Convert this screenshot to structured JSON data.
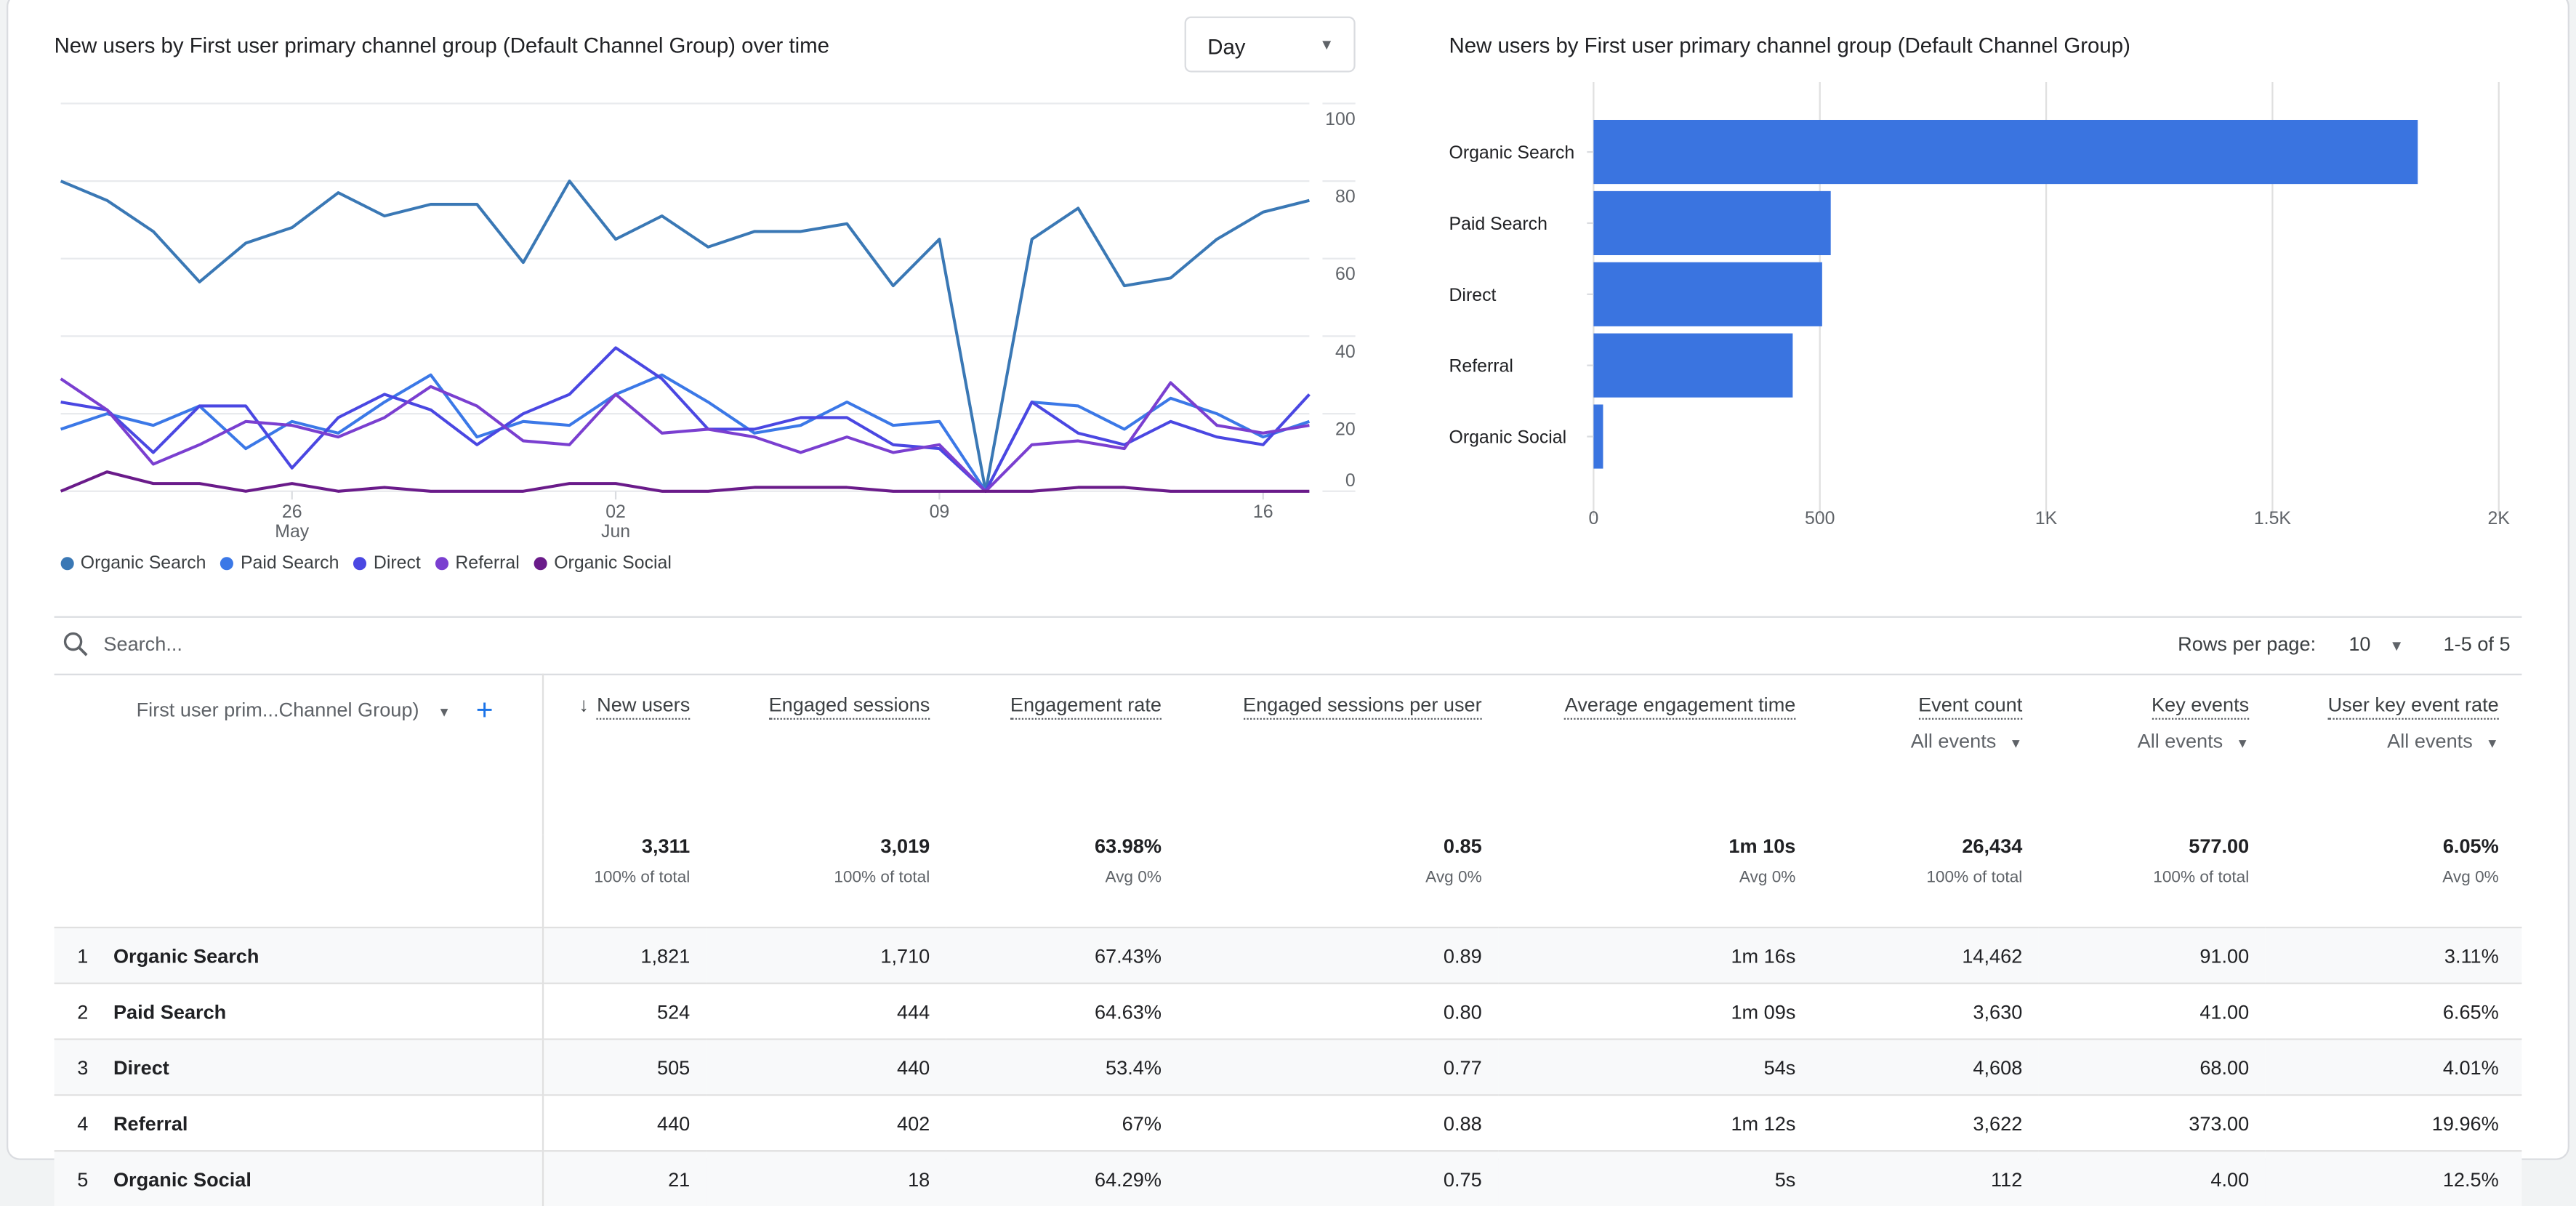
{
  "line_card": {
    "title": "New users by First user primary channel group (Default Channel Group) over time",
    "granularity": "Day"
  },
  "bar_card": {
    "title": "New users by First user primary channel group (Default Channel Group)"
  },
  "chart_data": [
    {
      "type": "line",
      "x": [
        "May 21",
        "May 22",
        "May 23",
        "May 24",
        "May 25",
        "May 26",
        "May 27",
        "May 28",
        "May 29",
        "May 30",
        "May 31",
        "Jun 01",
        "Jun 02",
        "Jun 03",
        "Jun 04",
        "Jun 05",
        "Jun 06",
        "Jun 07",
        "Jun 08",
        "Jun 09",
        "Jun 10",
        "Jun 11",
        "Jun 12",
        "Jun 13",
        "Jun 14",
        "Jun 15",
        "Jun 16",
        "Jun 17"
      ],
      "x_ticks": [
        {
          "at": "May 26",
          "label": "26",
          "sub": "May"
        },
        {
          "at": "Jun 02",
          "label": "02",
          "sub": "Jun"
        },
        {
          "at": "Jun 09",
          "label": "09",
          "sub": ""
        },
        {
          "at": "Jun 16",
          "label": "16",
          "sub": ""
        }
      ],
      "y_ticks": [
        "0",
        "20",
        "40",
        "60",
        "80",
        "100"
      ],
      "ylim": [
        0,
        100
      ],
      "y_axis_side": "right",
      "grid": true,
      "legend_position": "bottom",
      "series": [
        {
          "name": "Organic Search",
          "color": "#3a78b5",
          "values": [
            80,
            75,
            67,
            54,
            64,
            68,
            77,
            71,
            74,
            74,
            59,
            80,
            65,
            71,
            63,
            67,
            67,
            69,
            53,
            65,
            0,
            65,
            73,
            53,
            55,
            65,
            72,
            75
          ]
        },
        {
          "name": "Paid Search",
          "color": "#3b78e7",
          "values": [
            16,
            20,
            17,
            22,
            11,
            18,
            15,
            23,
            30,
            14,
            18,
            17,
            25,
            30,
            23,
            15,
            17,
            23,
            17,
            18,
            0,
            23,
            22,
            16,
            24,
            20,
            14,
            18
          ]
        },
        {
          "name": "Direct",
          "color": "#4a47e2",
          "values": [
            23,
            21,
            10,
            22,
            22,
            6,
            19,
            25,
            21,
            12,
            20,
            25,
            37,
            29,
            16,
            16,
            19,
            19,
            12,
            11,
            0,
            23,
            15,
            12,
            18,
            14,
            12,
            25
          ]
        },
        {
          "name": "Referral",
          "color": "#7a3fd0",
          "values": [
            29,
            21,
            7,
            12,
            18,
            17,
            14,
            19,
            27,
            22,
            13,
            12,
            25,
            15,
            16,
            14,
            10,
            14,
            10,
            12,
            0,
            12,
            13,
            11,
            28,
            17,
            15,
            17
          ]
        },
        {
          "name": "Organic Social",
          "color": "#6a1b8a",
          "values": [
            0,
            5,
            2,
            2,
            0,
            2,
            0,
            1,
            0,
            0,
            0,
            2,
            2,
            0,
            0,
            1,
            1,
            1,
            0,
            0,
            0,
            0,
            1,
            1,
            0,
            0,
            0,
            0
          ]
        }
      ]
    },
    {
      "type": "bar",
      "orientation": "horizontal",
      "categories": [
        "Organic Search",
        "Paid Search",
        "Direct",
        "Referral",
        "Organic Social"
      ],
      "values": [
        1821,
        524,
        505,
        440,
        21
      ],
      "color": "#3a74e0",
      "xlim": [
        0,
        2000
      ],
      "x_ticks": [
        "0",
        "500",
        "1K",
        "1.5K",
        "2K"
      ],
      "grid": true
    }
  ],
  "table": {
    "search_placeholder": "Search...",
    "rows_per_page_label": "Rows per page:",
    "rows_per_page": "10",
    "range": "1-5 of 5",
    "dimension_header": "First user prim...Channel Group)",
    "columns": [
      {
        "label": "New users",
        "sub": "",
        "total": "3,311",
        "total_sub": "100% of total",
        "sorted": true
      },
      {
        "label": "Engaged sessions",
        "sub": "",
        "total": "3,019",
        "total_sub": "100% of total"
      },
      {
        "label": "Engagement rate",
        "sub": "",
        "total": "63.98%",
        "total_sub": "Avg 0%"
      },
      {
        "label": "Engaged sessions per user",
        "sub": "",
        "total": "0.85",
        "total_sub": "Avg 0%"
      },
      {
        "label": "Average engagement time",
        "sub": "",
        "total": "1m 10s",
        "total_sub": "Avg 0%"
      },
      {
        "label": "Event count",
        "sub": "All events",
        "total": "26,434",
        "total_sub": "100% of total"
      },
      {
        "label": "Key events",
        "sub": "All events",
        "total": "577.00",
        "total_sub": "100% of total"
      },
      {
        "label": "User key event rate",
        "sub": "All events",
        "total": "6.05%",
        "total_sub": "Avg 0%"
      }
    ],
    "rows": [
      {
        "n": "1",
        "label": "Organic Search",
        "cells": [
          "1,821",
          "1,710",
          "67.43%",
          "0.89",
          "1m 16s",
          "14,462",
          "91.00",
          "3.11%"
        ]
      },
      {
        "n": "2",
        "label": "Paid Search",
        "cells": [
          "524",
          "444",
          "64.63%",
          "0.80",
          "1m 09s",
          "3,630",
          "41.00",
          "6.65%"
        ]
      },
      {
        "n": "3",
        "label": "Direct",
        "cells": [
          "505",
          "440",
          "53.4%",
          "0.77",
          "54s",
          "4,608",
          "68.00",
          "4.01%"
        ]
      },
      {
        "n": "4",
        "label": "Referral",
        "cells": [
          "440",
          "402",
          "67%",
          "0.88",
          "1m 12s",
          "3,622",
          "373.00",
          "19.96%"
        ]
      },
      {
        "n": "5",
        "label": "Organic Social",
        "cells": [
          "21",
          "18",
          "64.29%",
          "0.75",
          "5s",
          "112",
          "4.00",
          "12.5%"
        ]
      }
    ]
  }
}
